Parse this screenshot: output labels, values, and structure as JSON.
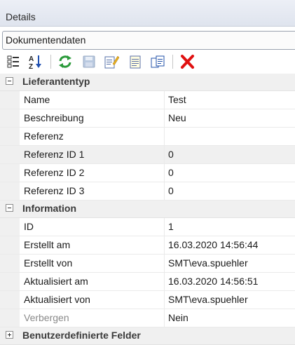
{
  "header": {
    "title": "Details"
  },
  "dropdown": {
    "selected": "Dokumentendaten"
  },
  "toolbar": {
    "buttons": [
      {
        "icon": "categorized-icon",
        "enabled": true
      },
      {
        "icon": "sort-alphabetical-icon",
        "enabled": true
      },
      {
        "icon": "refresh-icon",
        "enabled": true
      },
      {
        "icon": "save-icon",
        "enabled": false
      },
      {
        "icon": "edit-icon",
        "enabled": true
      },
      {
        "icon": "document-icon",
        "enabled": true
      },
      {
        "icon": "copy-icon",
        "enabled": true
      },
      {
        "icon": "delete-icon",
        "enabled": true
      }
    ]
  },
  "groups": [
    {
      "name": "Lieferantentyp",
      "expanded": true,
      "rows": [
        {
          "name": "Name",
          "value": "Test"
        },
        {
          "name": "Beschreibung",
          "value": "Neu"
        },
        {
          "name": "Referenz",
          "value": ""
        },
        {
          "name": "Referenz ID 1",
          "value": "0"
        },
        {
          "name": "Referenz ID 2",
          "value": "0"
        },
        {
          "name": "Referenz ID 3",
          "value": "0"
        }
      ]
    },
    {
      "name": "Information",
      "expanded": true,
      "rows": [
        {
          "name": "ID",
          "value": "1"
        },
        {
          "name": "Erstellt am",
          "value": "16.03.2020 14:56:44"
        },
        {
          "name": "Erstellt von",
          "value": "SMT\\eva.spuehler"
        },
        {
          "name": "Aktualisiert am",
          "value": "16.03.2020 14:56:51"
        },
        {
          "name": "Aktualisiert von",
          "value": "SMT\\eva.spuehler"
        },
        {
          "name": "Verbergen",
          "value": "Nein"
        }
      ]
    },
    {
      "name": "Benutzerdefinierte Felder",
      "expanded": false,
      "rows": []
    }
  ],
  "colors": {
    "selected_row": "#f0f0f0",
    "delete": "#e01010",
    "refresh": "#2a9a3a"
  }
}
